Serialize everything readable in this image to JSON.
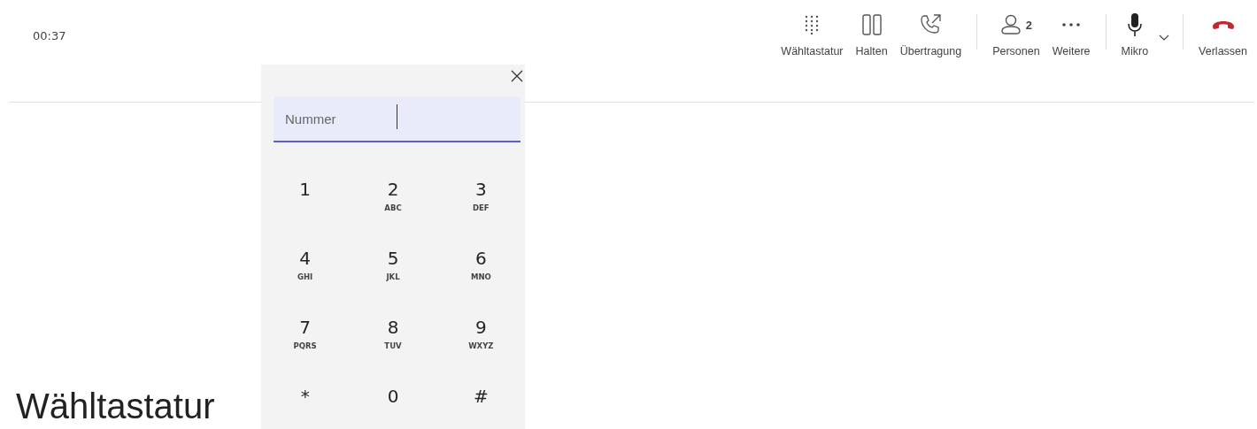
{
  "timer": "00:37",
  "toolbar": [
    {
      "kind": "dialpad",
      "label": "Wähltastatur"
    },
    {
      "kind": "hold",
      "label": "Halten"
    },
    {
      "kind": "transfer",
      "label": "Übertragung"
    },
    {
      "kind": "separator"
    },
    {
      "kind": "people",
      "label": "Personen",
      "count": "2"
    },
    {
      "kind": "more",
      "label": "Weitere"
    },
    {
      "kind": "separator"
    },
    {
      "kind": "mic",
      "label": "Mikro"
    },
    {
      "kind": "chevron"
    },
    {
      "kind": "separator"
    },
    {
      "kind": "leave",
      "label": "Verlassen"
    }
  ],
  "dialpad": {
    "placeholder": "Nummer",
    "keys": [
      {
        "digit": "1"
      },
      {
        "digit": "2",
        "letters": "ABC"
      },
      {
        "digit": "3",
        "letters": "DEF"
      },
      {
        "digit": "4",
        "letters": "GHI"
      },
      {
        "digit": "5",
        "letters": "JKL"
      },
      {
        "digit": "6",
        "letters": "MNO"
      },
      {
        "digit": "7",
        "letters": "PQRS"
      },
      {
        "digit": "8",
        "letters": "TUV"
      },
      {
        "digit": "9",
        "letters": "WXYZ"
      },
      {
        "digit": "*"
      },
      {
        "digit": "0"
      },
      {
        "digit": "#"
      }
    ]
  },
  "heading": "Wähltastatur"
}
